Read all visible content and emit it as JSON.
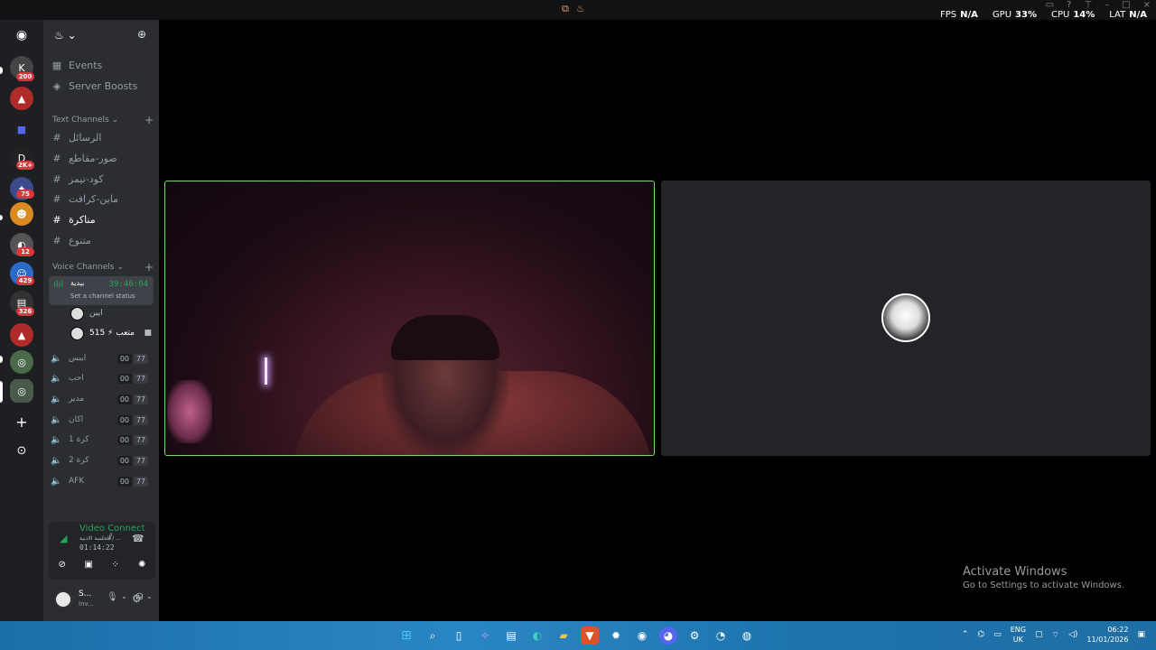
{
  "overlay": {
    "fps_label": "FPS",
    "fps_value": "N/A",
    "gpu_label": "GPU",
    "gpu_value": "33%",
    "cpu_label": "CPU",
    "cpu_value": "14%",
    "lat_label": "LAT",
    "lat_value": "N/A"
  },
  "server_rail": {
    "badges": [
      "200",
      "2K+",
      "75",
      "12",
      "429",
      "326"
    ]
  },
  "sidebar": {
    "events": "Events",
    "boosts": "Server Boosts",
    "text_category": "Text Channels",
    "text_channels": [
      "الرسائل",
      "صور-مقاطع",
      "كود-تيمز",
      "ماين-كرافت",
      "مناكرة",
      "متنوع"
    ],
    "voice_category": "Voice Channels",
    "live_channel": {
      "name": "بيدية",
      "time": "39:46:04",
      "status": "Set a channel status"
    },
    "members": [
      {
        "name": "ايبن"
      },
      {
        "name": "515 ⚡ متعب"
      }
    ],
    "voice_channels": [
      {
        "name": "ايبس",
        "count": "00",
        "limit": "77"
      },
      {
        "name": "احب",
        "count": "00",
        "limit": "77"
      },
      {
        "name": "مدير",
        "count": "00",
        "limit": "77"
      },
      {
        "name": "اكان",
        "count": "00",
        "limit": "77"
      },
      {
        "name": "1 كرة",
        "count": "00",
        "limit": "77"
      },
      {
        "name": "2 كرة",
        "count": "00",
        "limit": "77"
      },
      {
        "name": "AFK",
        "count": "00",
        "limit": "77"
      }
    ]
  },
  "voice_panel": {
    "title": "Video Connected",
    "subtitle": "الجلسة الادبية / ...",
    "time": "01:14:22"
  },
  "user": {
    "name": "S...",
    "status": "Inv..."
  },
  "watermark": {
    "line1": "Activate Windows",
    "line2": "Go to Settings to activate Windows."
  },
  "tray": {
    "lang1": "ENG",
    "lang2": "UK",
    "time": "06:22",
    "date": "11/01/2026"
  },
  "colors": {
    "accent_green": "#23a55a",
    "badge_red": "#da373c",
    "sidebar_bg": "#2b2d31",
    "rail_bg": "#1e1f22"
  }
}
